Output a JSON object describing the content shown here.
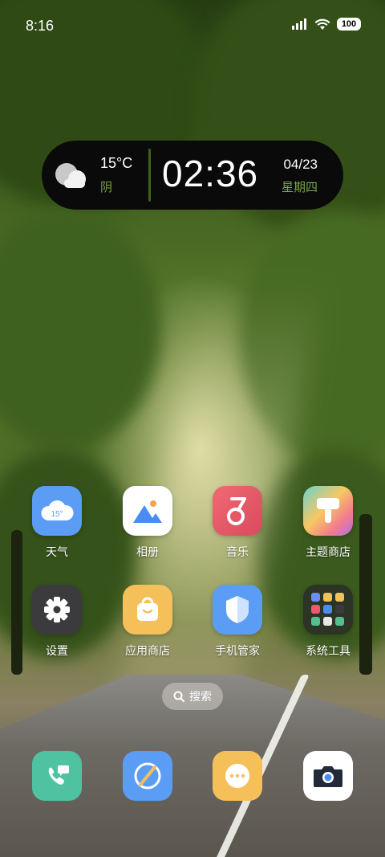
{
  "status_bar": {
    "time": "8:16",
    "battery": "100",
    "icons": [
      "signal-icon",
      "wifi-icon",
      "battery-icon"
    ]
  },
  "widget": {
    "temperature": "15°C",
    "condition": "阴",
    "time": "02:36",
    "date": "04/23",
    "weekday": "星期四",
    "weather_icon": "cloudy-icon"
  },
  "apps": [
    {
      "label": "天气",
      "icon": "weather-icon",
      "badge_text": "15°",
      "color": "#5b9cf5"
    },
    {
      "label": "相册",
      "icon": "gallery-icon",
      "color": "#ffffff"
    },
    {
      "label": "音乐",
      "icon": "music-icon",
      "color": "#e05a6a"
    },
    {
      "label": "主题商店",
      "icon": "theme-store-icon",
      "color": "#f2a36a"
    },
    {
      "label": "设置",
      "icon": "settings-icon",
      "color": "#3b3b3d"
    },
    {
      "label": "应用商店",
      "icon": "app-store-icon",
      "color": "#f5c05a"
    },
    {
      "label": "手机管家",
      "icon": "phone-manager-icon",
      "color": "#5b9cf5"
    },
    {
      "label": "系统工具",
      "icon": "system-tools-folder-icon",
      "color": "#2b2b2b"
    }
  ],
  "search": {
    "label": "搜索"
  },
  "dock": [
    {
      "name": "phone",
      "icon": "phone-icon",
      "color": "#4fc3a1"
    },
    {
      "name": "browser",
      "icon": "browser-icon",
      "color": "#5b9cf5"
    },
    {
      "name": "messages",
      "icon": "messages-icon",
      "color": "#f5c05a"
    },
    {
      "name": "camera",
      "icon": "camera-icon",
      "color": "#ffffff"
    }
  ]
}
